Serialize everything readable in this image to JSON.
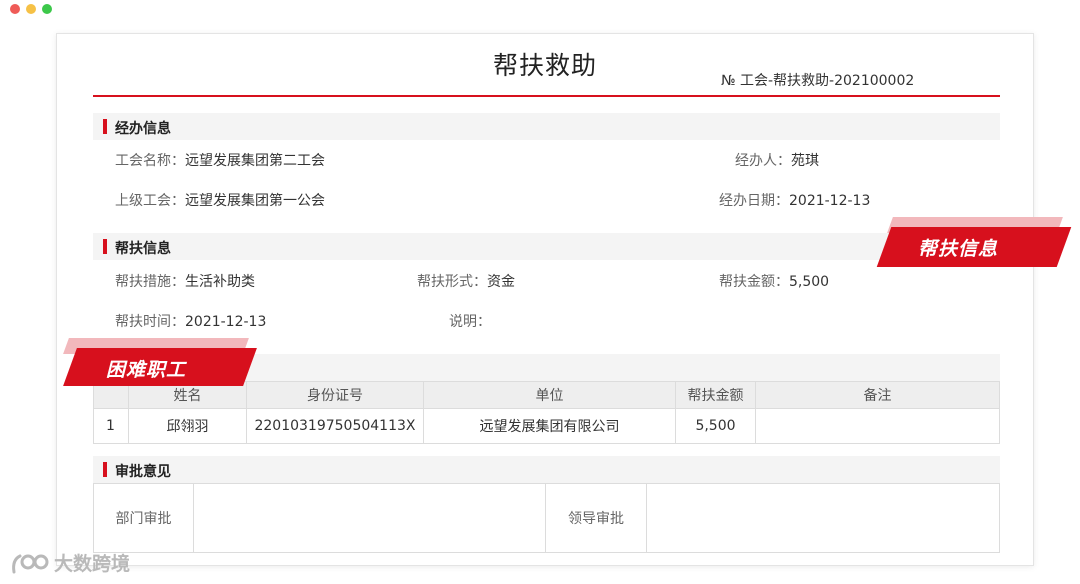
{
  "document": {
    "title": "帮扶救助",
    "number": "№  工会-帮扶救助-202100002"
  },
  "handling": {
    "heading": "经办信息",
    "union_name_label": "工会名称：",
    "union_name_value": "远望发展集团第二工会",
    "handler_label": "经办人：",
    "handler_value": "苑琪",
    "parent_union_label": "上级工会：",
    "parent_union_value": "远望发展集团第一公会",
    "date_label": "经办日期：",
    "date_value": "2021-12-13"
  },
  "assistance": {
    "heading": "帮扶信息",
    "measure_label": "帮扶措施：",
    "measure_value": "生活补助类",
    "form_label": "帮扶形式：",
    "form_value": "资金",
    "amount_label": "帮扶金额：",
    "amount_value": "5,500",
    "time_label": "帮扶时间：",
    "time_value": "2021-12-13",
    "note_label": "说明：",
    "note_value": ""
  },
  "workers_table": {
    "columns": [
      "",
      "姓名",
      "身份证号",
      "单位",
      "帮扶金额",
      "备注"
    ],
    "rows": [
      [
        "1",
        "邱翎羽",
        "22010319750504113X",
        "远望发展集团有限公司",
        "5,500",
        ""
      ]
    ]
  },
  "approval": {
    "heading": "审批意见",
    "dept_label": "部门审批",
    "dept_value": "",
    "leader_label": "领导审批",
    "leader_value": ""
  },
  "ribbons": {
    "assistance_info": "帮扶信息",
    "needy_workers": "困难职工"
  },
  "watermark": "大数跨境",
  "colors": {
    "accent": "#d7101d",
    "section_bg": "#f4f4f4"
  }
}
